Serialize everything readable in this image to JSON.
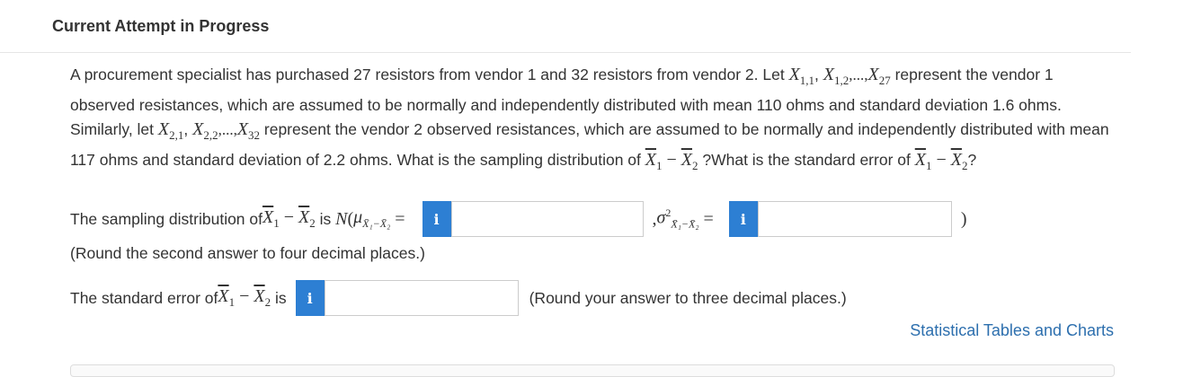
{
  "header": {
    "title": "Current Attempt in Progress"
  },
  "question": {
    "part1": "A procurement specialist has purchased 27 resistors from vendor 1 and 32 resistors from vendor 2. Let ",
    "x11": "X",
    "x11_sub": "1,1",
    "comma1": ", ",
    "x12": "X",
    "x12_sub": "1,2",
    "dots1": ",...,",
    "x127": "X",
    "x127_sub": "27",
    "part2": " represent the vendor 1 observed resistances, which are assumed to be normally and independently distributed with mean 110 ohms and standard deviation 1.6 ohms. Similarly, let ",
    "x21": "X",
    "x21_sub": "2,1",
    "comma2": ", ",
    "x22": "X",
    "x22_sub": "2,2",
    "dots2": ",...,",
    "x232": "X",
    "x232_sub": "32",
    "part3": " represent the vendor 2 observed resistances, which are assumed to be normally and independently distributed with mean 117 ohms and standard deviation of 2.2 ohms. What is the sampling distribution of ",
    "part4": "?What is the standard error of ",
    "part5": "?"
  },
  "diff": {
    "x1": "X",
    "sub1": "1",
    "minus": " − ",
    "x2": "X",
    "sub2": "2"
  },
  "row1": {
    "label": "The sampling distribution of ",
    "is": " is ",
    "N": "N",
    "paren_open": "(",
    "mu": "μ",
    "mu_sub": "X̄₁−X̄₂",
    "eq": " = ",
    "comma": ",",
    "sigma": "σ",
    "sigma_sup": "2",
    "sigma_sub": "X̄₁−X̄₂",
    "paren_close": ")",
    "info_icon": "i",
    "mean_value": "",
    "variance_value": ""
  },
  "note1": "(Round the second answer to four decimal places.)",
  "row2": {
    "label": "The standard error of ",
    "is": " is",
    "info_icon": "i",
    "value": "",
    "note": "(Round your answer to three decimal places.)"
  },
  "link": {
    "label": "Statistical Tables and Charts"
  },
  "colors": {
    "accent": "#2d7fd3",
    "link": "#2d6fae"
  }
}
